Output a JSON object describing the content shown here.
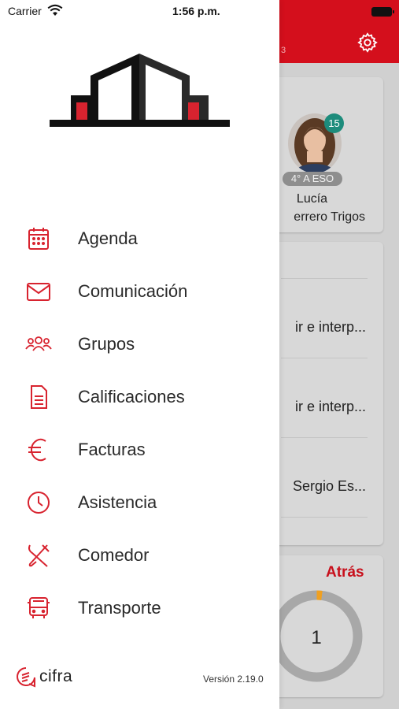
{
  "status_bar": {
    "carrier": "Carrier",
    "time": "1:56 p.m."
  },
  "background": {
    "header_fragment": "3",
    "student": {
      "badge_count": "15",
      "grade": "4° A ESO",
      "first_name": "Lucía",
      "surname": "errero Trigos"
    },
    "list_items": [
      "ir e interp...",
      "ir e interp...",
      "Sergio Es..."
    ],
    "back_label": "Atrás",
    "donut_value": "1",
    "accent_color": "#d40f1c"
  },
  "drawer": {
    "menu": [
      {
        "label": "Agenda",
        "icon": "calendar-icon"
      },
      {
        "label": "Comunicación",
        "icon": "mail-icon"
      },
      {
        "label": "Grupos",
        "icon": "group-icon"
      },
      {
        "label": "Calificaciones",
        "icon": "document-icon"
      },
      {
        "label": "Facturas",
        "icon": "euro-icon"
      },
      {
        "label": "Asistencia",
        "icon": "clock-icon"
      },
      {
        "label": "Comedor",
        "icon": "cutlery-icon"
      },
      {
        "label": "Transporte",
        "icon": "bus-icon"
      }
    ],
    "footer": {
      "brand": "cifra",
      "version": "Versión 2.19.0"
    }
  }
}
